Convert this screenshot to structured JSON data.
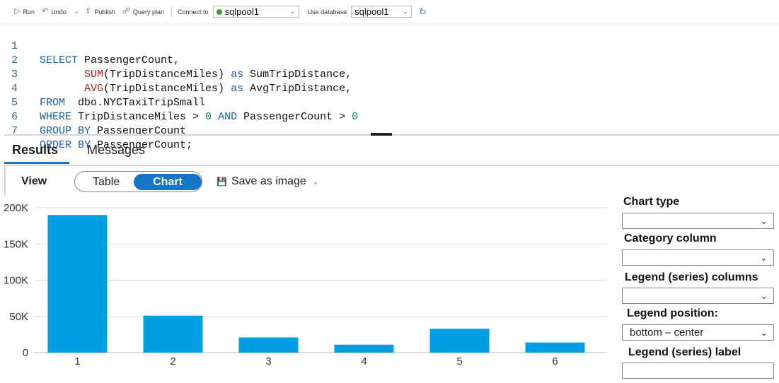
{
  "toolbar": {
    "run_label": "Run",
    "undo_label": "Undo",
    "publish_label": "Publish",
    "query_plan_label": "Query plan",
    "connect_to_label": "Connect to",
    "connect_value": "sqlpool1",
    "use_database_label": "Use database",
    "database_value": "sqlpool1",
    "status_color": "#3c9e3c"
  },
  "editor": {
    "line_numbers": [
      "1",
      "2",
      "3",
      "4",
      "5",
      "6",
      "7"
    ],
    "lines": [
      "SELECT PassengerCount,",
      "       SUM(TripDistanceMiles) as SumTripDistance,",
      "       AVG(TripDistanceMiles) as AvgTripDistance,",
      "FROM  dbo.NYCTaxiTripSmall",
      "WHERE TripDistanceMiles > 0 AND PassengerCount > 0",
      "GROUP BY PassengerCount",
      "ORDER BY PassengerCount;"
    ]
  },
  "tabs": {
    "results": "Results",
    "messages": "Messages"
  },
  "view": {
    "label": "View",
    "table_label": "Table",
    "chart_label": "Chart",
    "save_image_label": "Save as image"
  },
  "panel": {
    "chart_type_label": "Chart type",
    "category_column_label": "Category column",
    "legend_series_columns_label": "Legend (series) columns",
    "legend_position_label": "Legend position:",
    "legend_position_value": "bottom – center",
    "legend_series_label_label": "Legend (series) label"
  },
  "chart_data": {
    "type": "bar",
    "categories": [
      "1",
      "2",
      "3",
      "4",
      "5",
      "6"
    ],
    "values": [
      190000,
      51000,
      21000,
      11000,
      33000,
      14000
    ],
    "yticks": [
      "0",
      "50K",
      "100K",
      "150K",
      "200K"
    ],
    "ylim": [
      0,
      200000
    ],
    "grid": true,
    "bar_color": "#009fe3"
  }
}
